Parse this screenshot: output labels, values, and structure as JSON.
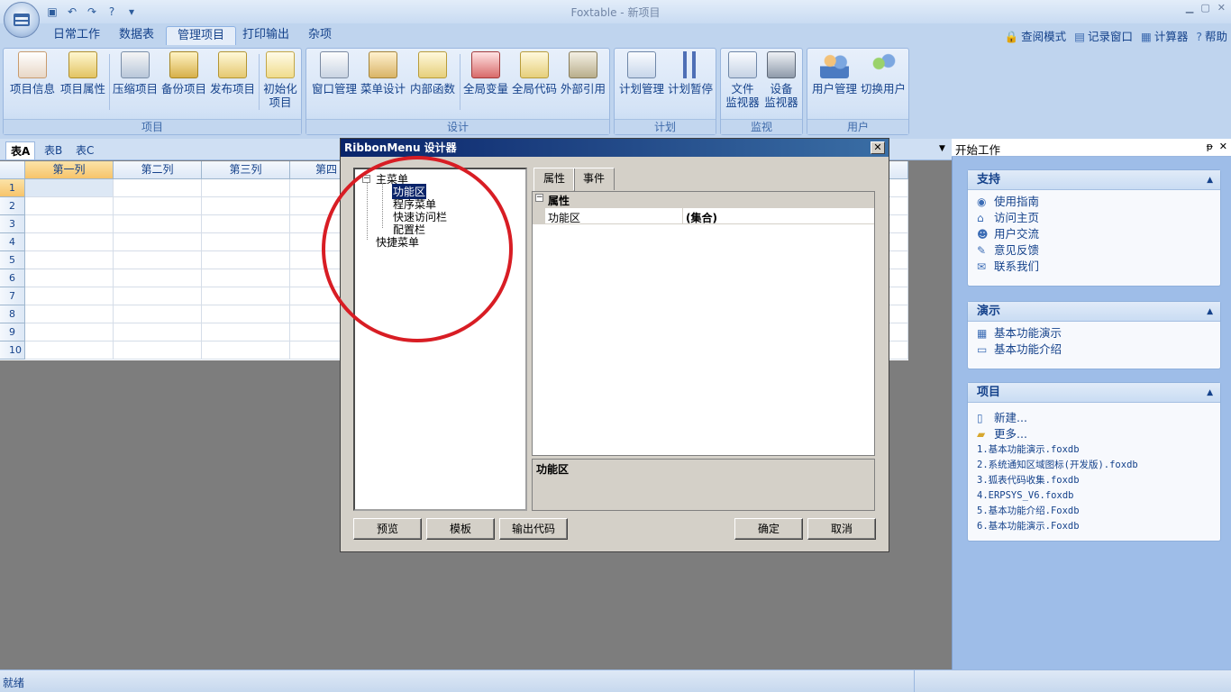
{
  "app": {
    "title": "Foxtable - 新项目"
  },
  "quick_access": {
    "items": [
      "save-icon",
      "undo-icon",
      "redo-icon",
      "help-icon",
      "customize-icon"
    ]
  },
  "tabs": [
    "日常工作",
    "数据表",
    "管理项目",
    "打印输出",
    "杂项"
  ],
  "active_tab": "管理项目",
  "right_links": [
    {
      "icon": "lock-icon",
      "label": "查阅模式"
    },
    {
      "icon": "window-icon",
      "label": "记录窗口"
    },
    {
      "icon": "calculator-icon",
      "label": "计算器"
    },
    {
      "icon": "help-icon",
      "label": "帮助"
    }
  ],
  "ribbon": {
    "groups": [
      {
        "label": "项目",
        "buttons": [
          "项目信息",
          "项目属性",
          "压缩项目",
          "备份项目",
          "发布项目",
          "初始化\n项目"
        ]
      },
      {
        "label": "设计",
        "buttons": [
          "窗口管理",
          "菜单设计",
          "内部函数",
          "全局变量",
          "全局代码",
          "外部引用"
        ]
      },
      {
        "label": "计划",
        "buttons": [
          "计划管理",
          "计划暂停"
        ]
      },
      {
        "label": "监视",
        "buttons": [
          "文件\n监视器",
          "设备\n监视器"
        ]
      },
      {
        "label": "用户",
        "buttons": [
          "用户管理",
          "切换用户"
        ]
      }
    ]
  },
  "sheet_tabs": [
    "表A",
    "表B",
    "表C"
  ],
  "grid": {
    "columns": [
      "第一列",
      "第二列",
      "第三列",
      "第四"
    ],
    "rows": [
      "1",
      "2",
      "3",
      "4",
      "5",
      "6",
      "7",
      "8",
      "9",
      "10"
    ]
  },
  "right_panel": {
    "title": "开始工作",
    "pin": "ᵽ",
    "close": "✕",
    "sections": [
      {
        "title": "支持",
        "items": [
          {
            "icon": "guide-icon",
            "label": "使用指南"
          },
          {
            "icon": "home-icon",
            "label": "访问主页"
          },
          {
            "icon": "users-icon",
            "label": "用户交流"
          },
          {
            "icon": "feedback-icon",
            "label": "意见反馈"
          },
          {
            "icon": "contact-icon",
            "label": "联系我们"
          }
        ]
      },
      {
        "title": "演示",
        "items": [
          {
            "icon": "table-icon",
            "label": "基本功能演示"
          },
          {
            "icon": "screen-icon",
            "label": "基本功能介绍"
          }
        ]
      },
      {
        "title": "项目",
        "items": [
          {
            "icon": "new-file-icon",
            "label": "新建..."
          },
          {
            "icon": "folder-icon",
            "label": "更多..."
          }
        ],
        "recent": [
          "1.基本功能演示.foxdb",
          "2.系统通知区域图标(开发版).foxdb",
          "3.狐表代码收集.foxdb",
          "4.ERPSYS_V6.foxdb",
          "5.基本功能介绍.Foxdb",
          "6.基本功能演示.Foxdb"
        ]
      }
    ]
  },
  "status": {
    "text": "就绪"
  },
  "dialog": {
    "title": "RibbonMenu 设计器",
    "tree": {
      "root": "主菜单",
      "children": [
        "功能区",
        "程序菜单",
        "快速访问栏",
        "配置栏"
      ],
      "selected": "功能区",
      "second_root": "快捷菜单"
    },
    "tabs": [
      "属性",
      "事件"
    ],
    "property_category": "属性",
    "properties": [
      {
        "name": "功能区",
        "value": "(集合)"
      }
    ],
    "description": "功能区",
    "buttons": {
      "preview": "预览",
      "template": "模板",
      "export": "输出代码",
      "ok": "确定",
      "cancel": "取消"
    }
  },
  "colors": {
    "accent": "#15428b",
    "ribbon_bg": "#bfd4ee",
    "annotation": "#d81d24"
  }
}
